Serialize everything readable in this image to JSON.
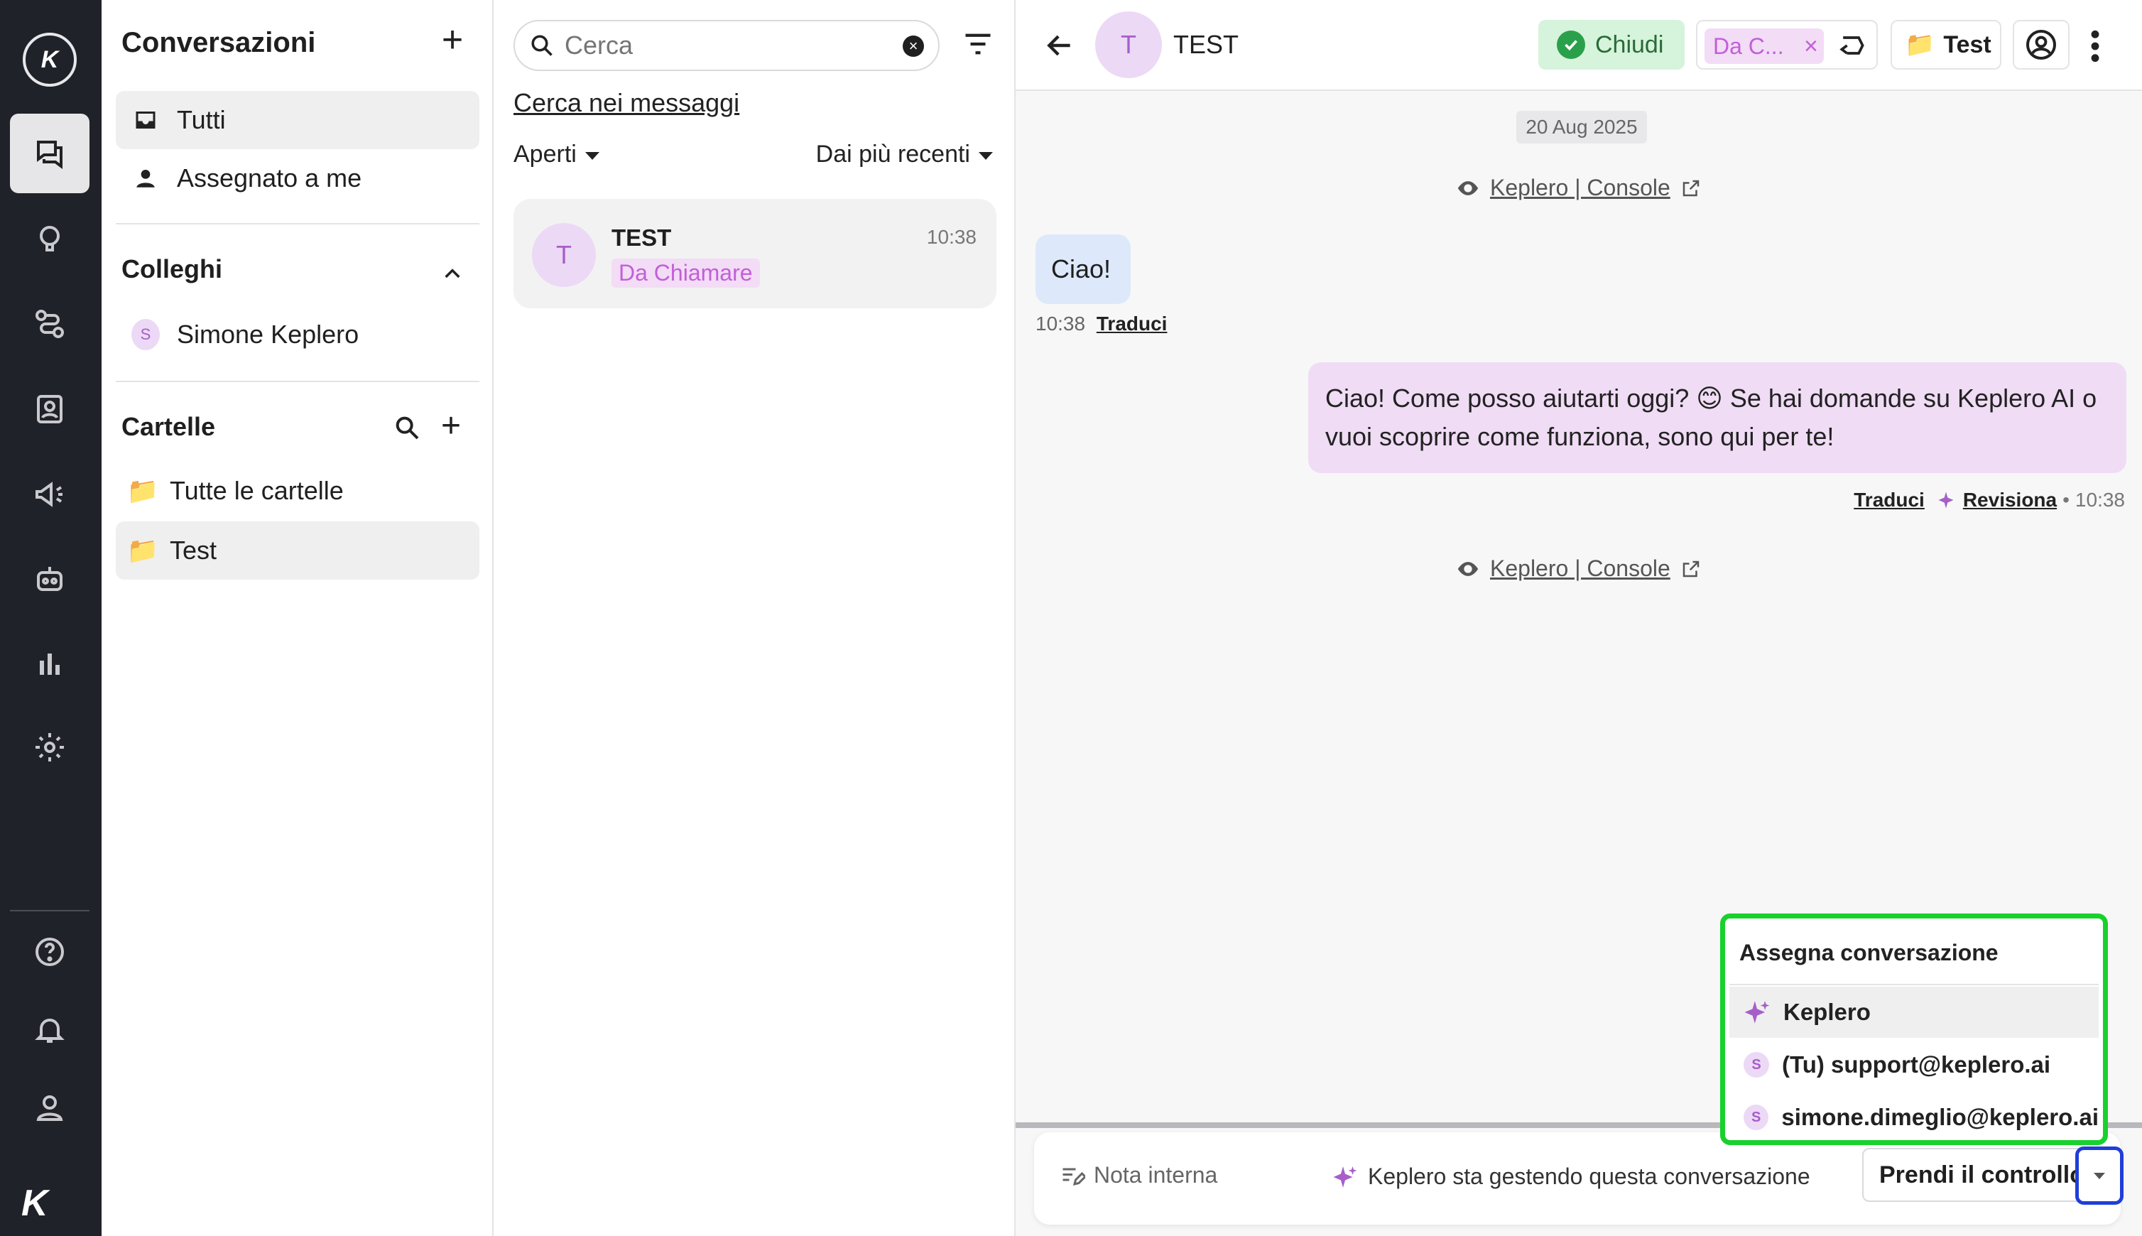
{
  "sidebar": {
    "title": "Conversazioni",
    "inbox_items": [
      {
        "label": "Tutti"
      },
      {
        "label": "Assegnato a me"
      }
    ],
    "colleagues_title": "Colleghi",
    "colleagues": [
      {
        "initial": "S",
        "label": "Simone Keplero"
      }
    ],
    "folders_title": "Cartelle",
    "folders": [
      {
        "label": "Tutte le cartelle"
      },
      {
        "label": "Test"
      }
    ]
  },
  "list": {
    "search_placeholder": "Cerca",
    "search_messages_link": "Cerca nei messaggi",
    "status_filter": "Aperti",
    "sort_filter": "Dai più recenti",
    "conversations": [
      {
        "initial": "T",
        "name": "TEST",
        "time": "10:38",
        "tag": "Da Chiamare"
      }
    ]
  },
  "chat": {
    "header": {
      "initial": "T",
      "name": "TEST",
      "close_label": "Chiudi",
      "tag_label": "Da C...",
      "folder_label": "Test"
    },
    "date_chip": "20 Aug 2025",
    "sys_link_label": "Keplero | Console",
    "incoming": {
      "text": "Ciao!",
      "time": "10:38",
      "translate": "Traduci"
    },
    "outgoing": {
      "text": "Ciao! Come posso aiutarti oggi? 😊 Se hai domande su Keplero AI o vuoi scoprire come funziona, sono qui per te!",
      "translate": "Traduci",
      "revise": "Revisiona",
      "time": "10:38"
    },
    "composer": {
      "note_label": "Nota interna",
      "status_text": "Keplero sta gestendo questa conversazione",
      "take_control": "Prendi il controllo"
    },
    "assign_menu": {
      "title": "Assegna conversazione",
      "options": [
        {
          "label": "Keplero",
          "icon": "sparkle-icon"
        },
        {
          "label": "(Tu) support@keplero.ai",
          "initial": "S"
        },
        {
          "label": "simone.dimeglio@keplero.ai",
          "initial": "S"
        }
      ]
    }
  },
  "colors": {
    "rail_bg": "#20222a",
    "accent_purple": "#a65fc9",
    "close_green": "#2aa04a",
    "highlight_green": "#19d12c",
    "highlight_blue": "#1f3fd8"
  }
}
